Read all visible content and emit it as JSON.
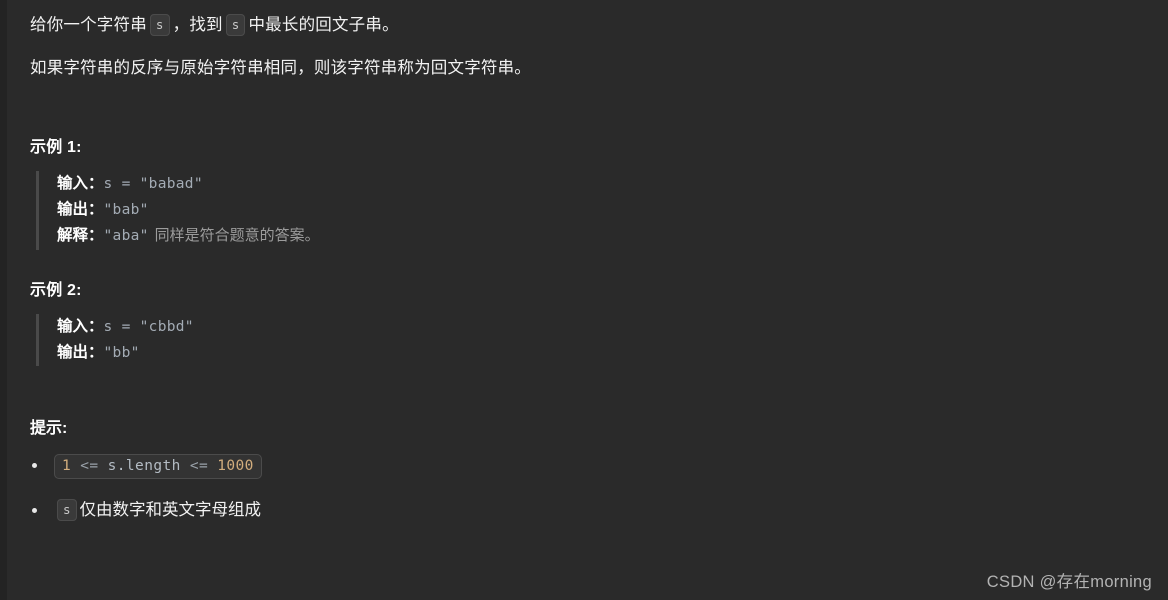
{
  "problem": {
    "paragraphs": [
      {
        "parts": [
          {
            "type": "text",
            "value": "给你一个字符串 "
          },
          {
            "type": "code",
            "value": "s"
          },
          {
            "type": "text",
            "value": "，找到 "
          },
          {
            "type": "code",
            "value": "s"
          },
          {
            "type": "text",
            "value": " 中最长的回文子串。"
          }
        ],
        "plain": "给你一个字符串 s，找到 s 中最长的回文子串。"
      },
      {
        "parts": [
          {
            "type": "text",
            "value": "如果字符串的反序与原始字符串相同，则该字符串称为回文字符串。"
          }
        ],
        "plain": "如果字符串的反序与原始字符串相同，则该字符串称为回文字符串。"
      }
    ],
    "paragraph_1_prefix": "给你一个字符串",
    "paragraph_1_mid": "，找到",
    "paragraph_1_suffix": "中最长的回文子串。",
    "paragraph_1_code_1": "s",
    "paragraph_1_code_2": "s",
    "paragraph_2": "如果字符串的反序与原始字符串相同，则该字符串称为回文字符串。"
  },
  "examples": [
    {
      "title": "示例 1:",
      "input_label": "输入：",
      "input_value": "s = \"babad\"",
      "output_label": "输出：",
      "output_value": "\"bab\"",
      "explain_label": "解释：",
      "explain_code": "\"aba\"",
      "explain_text": "同样是符合题意的答案。"
    },
    {
      "title": "示例 2:",
      "input_label": "输入：",
      "input_value": "s = \"cbbd\"",
      "output_label": "输出：",
      "output_value": "\"bb\""
    }
  ],
  "hints": {
    "title": "提示:",
    "items": [
      {
        "kind": "code",
        "code_num_1": "1",
        "code_op_1": " <= ",
        "code_ident": "s.length",
        "code_op_2": " <= ",
        "code_num_2": "1000",
        "full": "1 <= s.length <= 1000"
      },
      {
        "kind": "code-then-text",
        "code": "s",
        "text": "仅由数字和英文字母组成"
      }
    ]
  },
  "watermark": {
    "text": "CSDN @存在morning"
  },
  "colors": {
    "background": "#2a2a2a",
    "text": "#f2f2f2",
    "muted": "#9c9c9c",
    "code_text": "#a3abb4",
    "number": "#d2ad7d",
    "quote_bar": "#4a4a4a",
    "badge_bg": "#3a3a3a",
    "badge_border": "#4b4b4b"
  }
}
